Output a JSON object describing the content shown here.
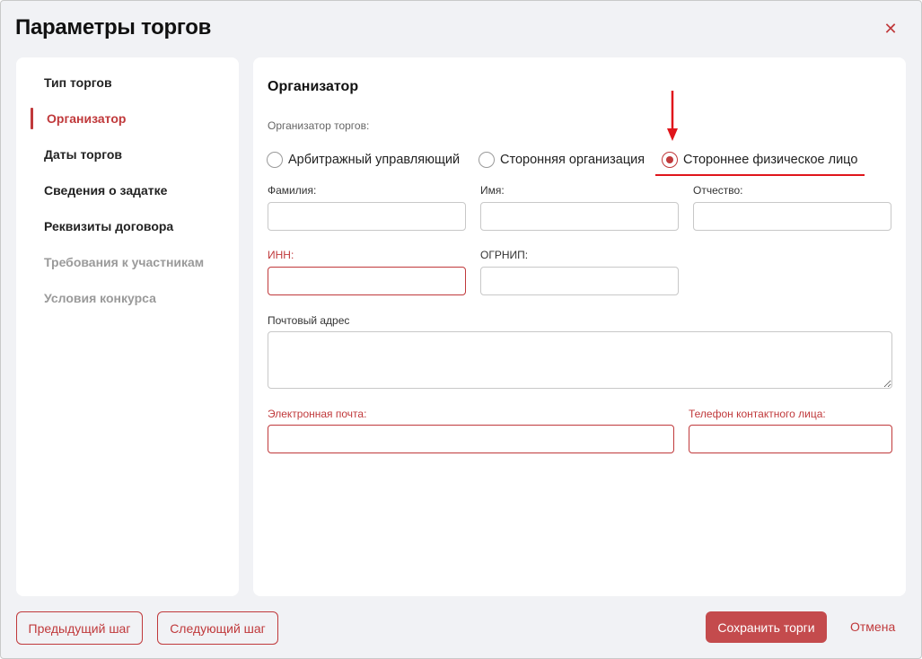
{
  "dialog": {
    "title": "Параметры торгов",
    "close_icon": "close-icon"
  },
  "sidebar": {
    "items": [
      {
        "label": "Тип торгов",
        "state": "normal"
      },
      {
        "label": "Организатор",
        "state": "active"
      },
      {
        "label": "Даты торгов",
        "state": "normal"
      },
      {
        "label": "Сведения о задатке",
        "state": "normal"
      },
      {
        "label": "Реквизиты договора",
        "state": "normal"
      },
      {
        "label": "Требования к участникам",
        "state": "disabled"
      },
      {
        "label": "Условия конкурса",
        "state": "disabled"
      }
    ]
  },
  "main": {
    "section_title": "Организатор",
    "organizer_label": "Организатор торгов:",
    "radios": [
      {
        "label": "Арбитражный управляющий",
        "checked": false
      },
      {
        "label": "Сторонняя организация",
        "checked": false
      },
      {
        "label": "Стороннее физическое лицо",
        "checked": true
      }
    ],
    "fields": {
      "last_name": {
        "label": "Фамилия:",
        "value": ""
      },
      "first_name": {
        "label": "Имя:",
        "value": ""
      },
      "patronymic": {
        "label": "Отчество:",
        "value": ""
      },
      "inn": {
        "label": "ИНН:",
        "value": "",
        "error": true
      },
      "ogrnip": {
        "label": "ОГРНИП:",
        "value": ""
      },
      "postal_address": {
        "label": "Почтовый адрес",
        "value": ""
      },
      "email": {
        "label": "Электронная почта:",
        "value": "",
        "error": true
      },
      "phone": {
        "label": "Телефон контактного лица:",
        "value": "",
        "error": true
      }
    }
  },
  "footer": {
    "prev_label": "Предыдущий шаг",
    "next_label": "Следующий шаг",
    "save_label": "Сохранить торги",
    "cancel_label": "Отмена"
  },
  "colors": {
    "accent": "#c0393b",
    "annotation": "#e0151b",
    "background": "#f1f2f5"
  }
}
